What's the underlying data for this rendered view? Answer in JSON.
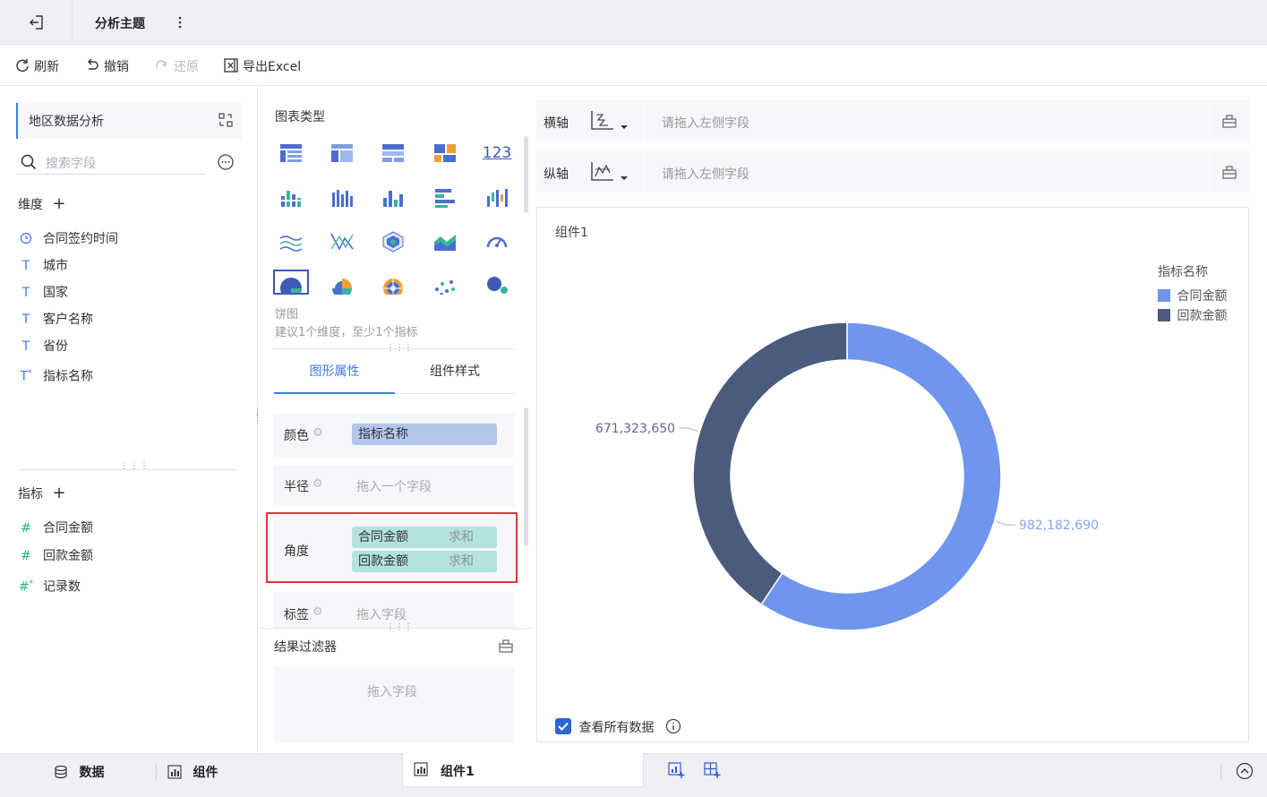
{
  "header": {
    "title": "分析主题",
    "back_icon": "exit-icon",
    "more_icon": "vertical-dots-icon"
  },
  "toolbar": {
    "refresh_label": "刷新",
    "undo_label": "撤销",
    "redo_label": "还原",
    "export_label": "导出Excel"
  },
  "left": {
    "dataset_name": "地区数据分析",
    "search_placeholder": "搜索字段",
    "dimensions_title": "维度",
    "dimensions": [
      {
        "label": "合同签约时间",
        "icon": "clock-icon"
      },
      {
        "label": "城市",
        "icon": "text-t-icon"
      },
      {
        "label": "国家",
        "icon": "text-t-icon"
      },
      {
        "label": "客户名称",
        "icon": "text-t-icon"
      },
      {
        "label": "省份",
        "icon": "text-t-icon"
      },
      {
        "label": "指标名称",
        "icon": "text-t-star-icon"
      }
    ],
    "measures_title": "指标",
    "measures": [
      {
        "label": "合同金额",
        "icon": "hash-icon"
      },
      {
        "label": "回款金额",
        "icon": "hash-icon"
      },
      {
        "label": "记录数",
        "icon": "hash-star-icon"
      }
    ]
  },
  "middle": {
    "chart_type_title": "图表类型",
    "selected_chart_name": "饼图",
    "selected_chart_hint": "建议1个维度，至少1个指标",
    "tabs": [
      "图形属性",
      "组件样式"
    ],
    "props": {
      "color_label": "颜色",
      "color_field": "指标名称",
      "radius_label": "半径",
      "radius_placeholder": "拖入一个字段",
      "angle_label": "角度",
      "angle_fields": [
        {
          "name": "合同金额",
          "agg": "求和"
        },
        {
          "name": "回款金额",
          "agg": "求和"
        }
      ],
      "label_label": "标签",
      "label_placeholder": "拖入字段"
    },
    "filter_title": "结果过滤器",
    "filter_placeholder": "拖入字段"
  },
  "axes": {
    "x_label": "横轴",
    "y_label": "纵轴",
    "x_placeholder": "请拖入左侧字段",
    "y_placeholder": "请拖入左侧字段"
  },
  "component": {
    "title": "组件1",
    "view_all_label": "查看所有数据",
    "view_all_checked": true
  },
  "chart_data": {
    "type": "pie",
    "style": "donut",
    "legend_title": "指标名称",
    "legend_position": "top-right",
    "slices": [
      {
        "name": "合同金额",
        "value": 982182690,
        "label": "982,182,690",
        "color": "#6f95ec"
      },
      {
        "name": "回款金额",
        "value": 671323650,
        "label": "671,323,650",
        "color": "#4b5b7d"
      }
    ]
  },
  "bottom": {
    "data_tab": "数据",
    "component_tab": "组件",
    "active_tab": "组件1"
  },
  "colors": {
    "accent": "#3d7ae5",
    "highlight_border": "#e0353b",
    "pill_blue": "#b3c6ec",
    "pill_green": "#b2e3dc"
  }
}
